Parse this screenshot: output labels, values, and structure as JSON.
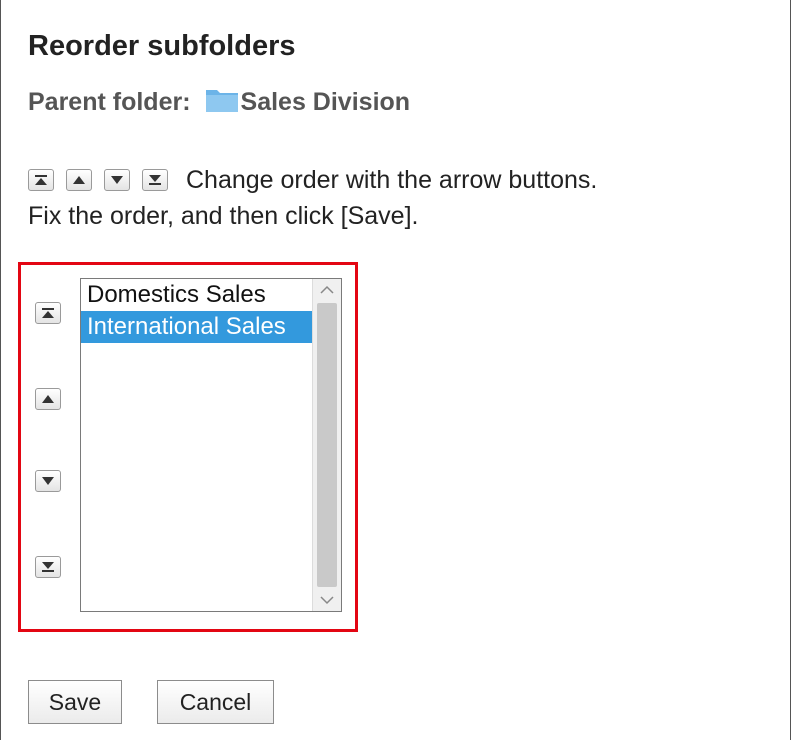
{
  "page": {
    "title": "Reorder subfolders",
    "parent_label": "Parent folder:",
    "parent_folder_name": "Sales Division",
    "folder_icon": "folder-icon",
    "folder_icon_color": "#6cb4e8"
  },
  "instructions": {
    "line1": "Change order with the arrow buttons.",
    "line2": "Fix the order, and then click [Save]."
  },
  "arrow_buttons": [
    {
      "name": "move-to-top",
      "icon": "move-to-top-icon"
    },
    {
      "name": "move-up",
      "icon": "move-up-icon"
    },
    {
      "name": "move-down",
      "icon": "move-down-icon"
    },
    {
      "name": "move-to-bottom",
      "icon": "move-to-bottom-icon"
    }
  ],
  "subfolders": {
    "items": [
      {
        "label": "Domestics Sales",
        "selected": false
      },
      {
        "label": "International Sales",
        "selected": true
      }
    ],
    "selection_color": "#3399dd"
  },
  "highlight_color": "#e30613",
  "actions": {
    "save_label": "Save",
    "cancel_label": "Cancel"
  }
}
